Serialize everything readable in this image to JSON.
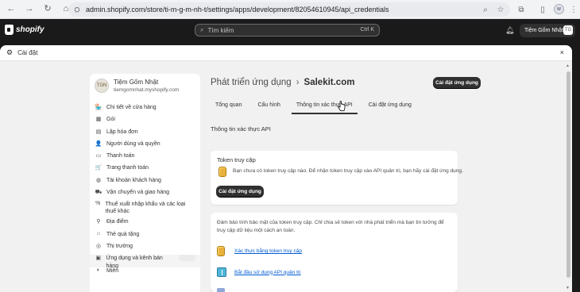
{
  "browser": {
    "url": "admin.shopify.com/store/ti-m-g-m-nh-t/settings/apps/development/82054610945/api_credentials",
    "back_icon": "←",
    "forward_icon": "→",
    "reload_icon": "↻",
    "home_icon": "⌂",
    "site_icon": "⛭",
    "profile_initials": "W"
  },
  "topbar": {
    "logo_text": "shopify",
    "search_placeholder": "Tìm kiếm",
    "search_shortcut": "Ctrl K",
    "store_button": "Tiệm Gốm Nhật",
    "store_initials": "TG"
  },
  "modal": {
    "title": "Cài đặt",
    "close_icon": "×"
  },
  "sidebar": {
    "store_name": "Tiệm Gốm Nhật",
    "store_domain": "tiemgomnhat.myshopify.com",
    "store_avatar": "TGN",
    "items": [
      {
        "label": "Chi tiết về cửa hàng",
        "icon": "🏪"
      },
      {
        "label": "Gói",
        "icon": "▦"
      },
      {
        "label": "Lập hóa đơn",
        "icon": "▤"
      },
      {
        "label": "Người dùng và quyền",
        "icon": "👤"
      },
      {
        "label": "Thanh toán",
        "icon": "▭"
      },
      {
        "label": "Trang thanh toán",
        "icon": "🛒"
      },
      {
        "label": "Tài khoản khách hàng",
        "icon": "◍"
      },
      {
        "label": "Vận chuyển và giao hàng",
        "icon": "⛟"
      },
      {
        "label": "Thuế xuất nhập khẩu và các loại thuế khác",
        "icon": "%"
      },
      {
        "label": "Địa điểm",
        "icon": "⚲"
      },
      {
        "label": "Thẻ quà tặng",
        "icon": "⌂"
      },
      {
        "label": "Thị trường",
        "icon": "◎"
      },
      {
        "label": "Ứng dụng và kênh bán hàng",
        "icon": "▣"
      },
      {
        "label": "Miền",
        "icon": "◐"
      }
    ]
  },
  "main": {
    "breadcrumb_parent": "Phát triển ứng dụng",
    "breadcrumb_sep": "›",
    "app_name": "Salekit.com",
    "install_button": "Cài đặt ứng dụng",
    "tabs": [
      {
        "label": "Tổng quan",
        "active": false
      },
      {
        "label": "Cấu hình",
        "active": false
      },
      {
        "label": "Thông tin xác thực API",
        "active": true
      },
      {
        "label": "Cài đặt ứng dụng",
        "active": false
      }
    ],
    "section_title": "Thông tin xác thực API",
    "token_card": {
      "title": "Token truy cập",
      "description": "Bạn chưa có token truy cập nào. Để nhận token truy cập vào API quản trị, bạn hãy cài đặt ứng dụng.",
      "button": "Cài đặt ứng dụng"
    },
    "security_card": {
      "description": "Đảm bảo tính bảo mật của token truy cập. Chỉ chia sẻ token với nhà phát triển mà bạn tin tưởng để truy cập dữ liệu một cách an toàn.",
      "links": [
        {
          "label": "Xác thực bằng token truy cập",
          "icon": "token-icon"
        },
        {
          "label": "Bắt đầu sử dụng API quản trị",
          "icon": "book-icon"
        }
      ]
    }
  }
}
